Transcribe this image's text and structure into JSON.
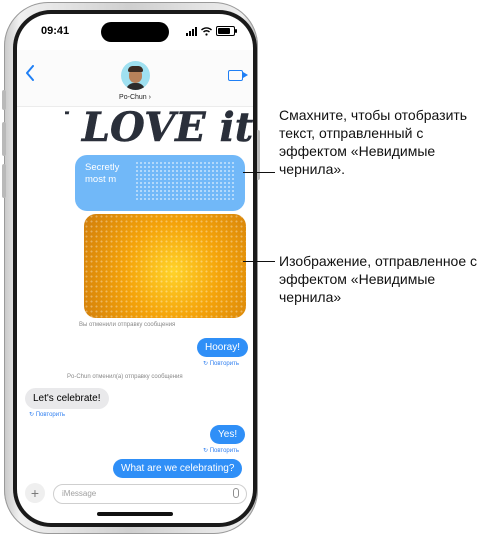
{
  "status_bar": {
    "time": "09:41"
  },
  "header": {
    "contact_name": "Po-Chun ›",
    "back_icon": "chevron-left-icon",
    "video_icon": "video-camera-icon"
  },
  "handwriting": {
    "text": "I LOVE it!"
  },
  "messages": {
    "ink_text_visible": "Secretly\nmost m",
    "system_unsent_mine": "Вы отменили отправку сообщения",
    "hooray": "Hooray!",
    "retry1": "↻ Повторить",
    "system_unsent_theirs": "Po-Chun отменил(а) отправку сообщения",
    "lets_celebrate": "Let's celebrate!",
    "retry2": "↻ Повторить",
    "yes": "Yes!",
    "retry3": "↻ Повторить",
    "what_celebrating": "What are we celebrating?"
  },
  "composer": {
    "placeholder": "iMessage",
    "plus_label": "+"
  },
  "callouts": {
    "top": "Смахните, чтобы отобразить текст, отправленный с эффектом «Невидимые чернила».",
    "bottom": "Изображение, отправленное с эффектом «Невидимые чернила»"
  },
  "colors": {
    "bubble_blue": "#2f8ff7",
    "link_blue": "#1f7ff5",
    "bubble_gray": "#e9e9eb"
  }
}
